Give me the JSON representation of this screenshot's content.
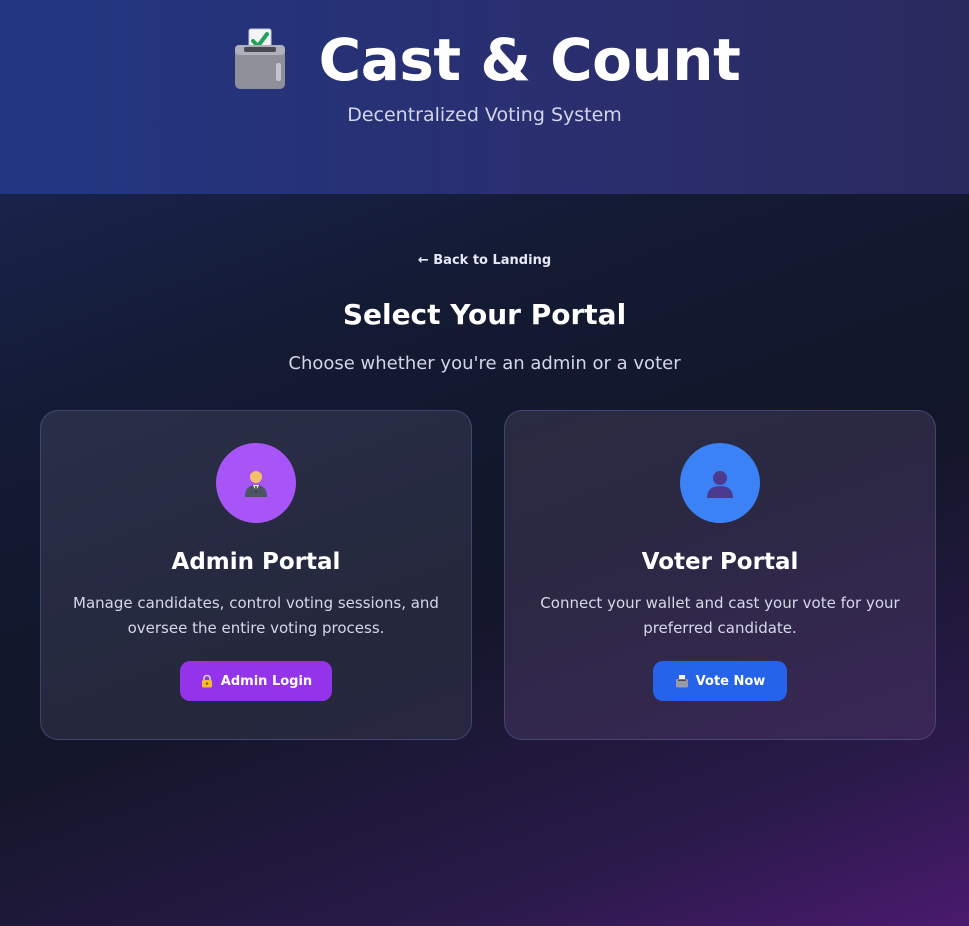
{
  "header": {
    "title": "Cast & Count",
    "subtitle": "Decentralized Voting System",
    "icon": "ballot-box-icon"
  },
  "nav": {
    "back_label": "← Back to Landing"
  },
  "main": {
    "title": "Select Your Portal",
    "subtitle": "Choose whether you're an admin or a voter"
  },
  "cards": [
    {
      "title": "Admin Portal",
      "description": "Manage candidates, control voting sessions, and oversee the entire voting process.",
      "button_label": "Admin Login",
      "icon": "admin-person-icon",
      "button_icon": "lock-icon",
      "accent": "#a855f7",
      "button_color": "#9333ea"
    },
    {
      "title": "Voter Portal",
      "description": "Connect your wallet and cast your vote for your preferred candidate.",
      "button_label": "Vote Now",
      "icon": "voter-silhouette-icon",
      "button_icon": "ballot-box-icon",
      "accent": "#3b82f6",
      "button_color": "#2563eb"
    }
  ]
}
